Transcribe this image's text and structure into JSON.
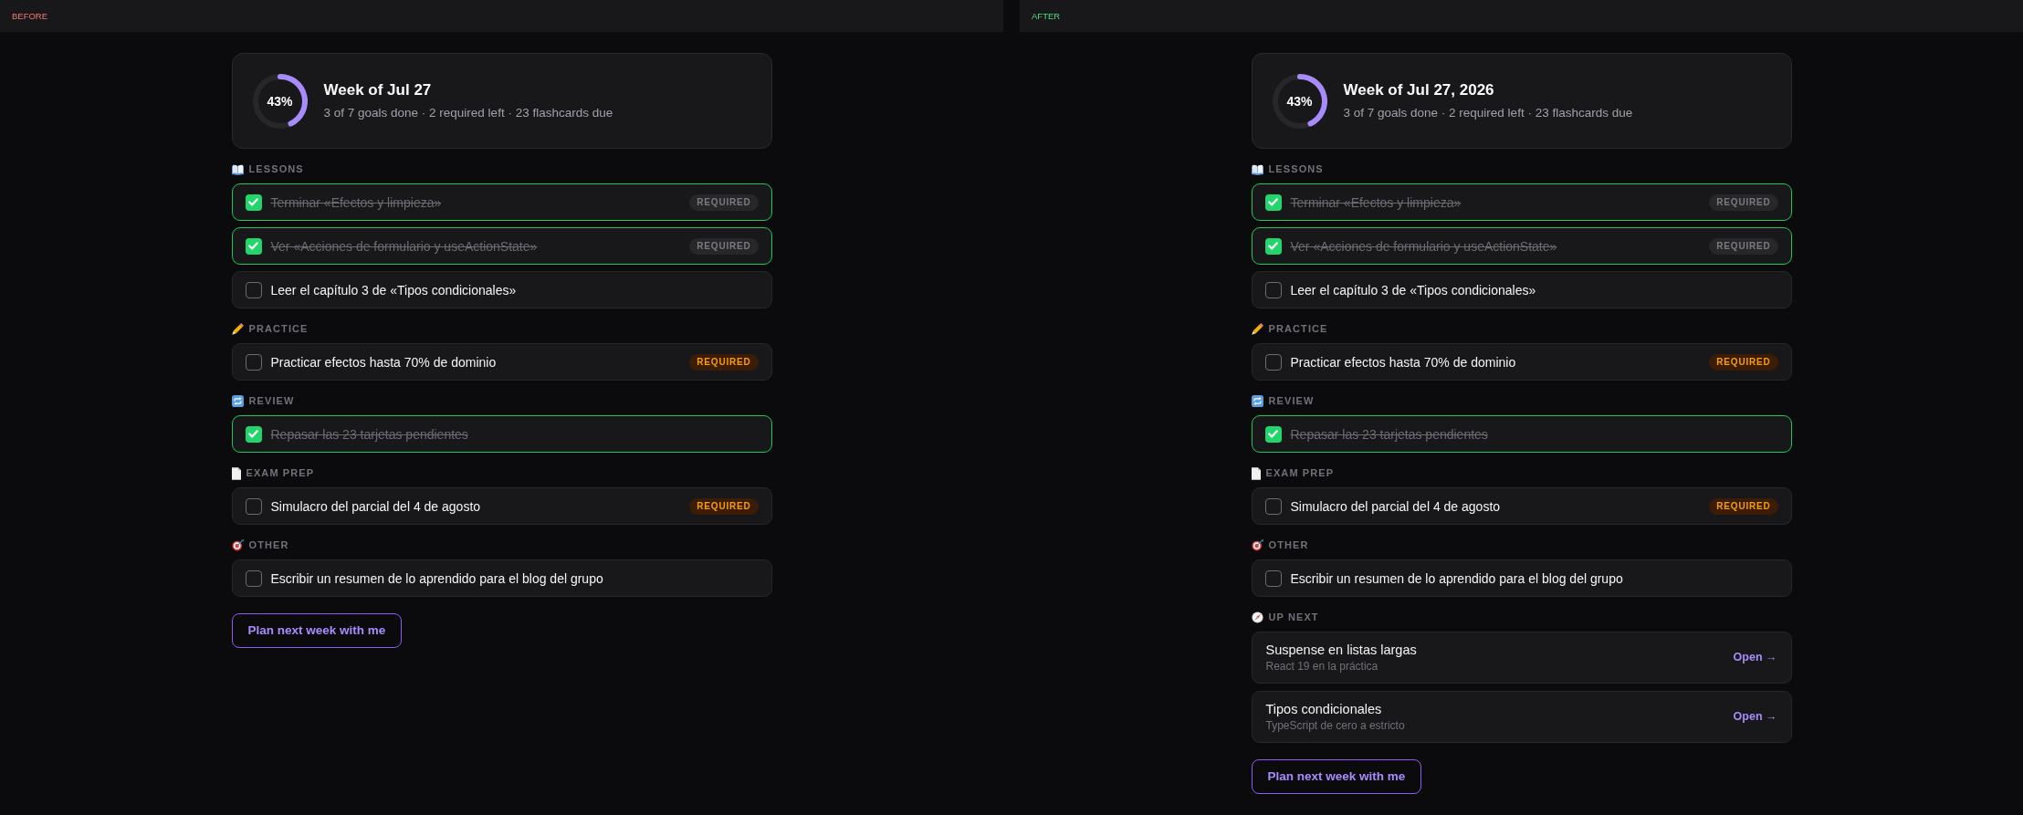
{
  "panes": [
    {
      "label": "BEFORE",
      "color": "#f27a72",
      "summary": {
        "percent": "43%",
        "level": 0.43,
        "title": "Week of Jul 27",
        "subtitle": "3 of 7 goals done · 2 required left · 23 flashcards due"
      },
      "sections": [
        {
          "kind": "lessons",
          "heading": "LESSONS",
          "items": [
            {
              "text": "Terminar «Efectos y limpieza»",
              "checked": true,
              "badge": "REQUIRED"
            },
            {
              "text": "Ver «Acciones de formulario y useActionState»",
              "checked": true,
              "badge": "REQUIRED"
            },
            {
              "text": "Leer el capítulo 3 de «Tipos condicionales»",
              "checked": false
            }
          ]
        },
        {
          "kind": "practice",
          "heading": "PRACTICE",
          "items": [
            {
              "text": "Practicar efectos hasta 70% de dominio",
              "checked": false,
              "badge": "REQUIRED"
            }
          ]
        },
        {
          "kind": "review",
          "heading": "REVIEW",
          "items": [
            {
              "text": "Repasar las 23 tarjetas pendientes",
              "checked": true
            }
          ]
        },
        {
          "kind": "exam_prep",
          "heading": "EXAM PREP",
          "items": [
            {
              "text": "Simulacro del parcial del 4 de agosto",
              "checked": false,
              "badge": "REQUIRED"
            }
          ]
        },
        {
          "kind": "other",
          "heading": "OTHER",
          "items": [
            {
              "text": "Escribir un resumen de lo aprendido para el blog del grupo",
              "checked": false
            }
          ]
        }
      ],
      "button": "Plan next week with me"
    },
    {
      "label": "AFTER",
      "color": "#4ade80",
      "summary": {
        "percent": "43%",
        "level": 0.43,
        "title": "Week of Jul 27, 2026",
        "subtitle": "3 of 7 goals done · 2 required left · 23 flashcards due"
      },
      "sections": [
        {
          "kind": "lessons",
          "heading": "LESSONS",
          "items": [
            {
              "text": "Terminar «Efectos y limpieza»",
              "checked": true,
              "badge": "REQUIRED"
            },
            {
              "text": "Ver «Acciones de formulario y useActionState»",
              "checked": true,
              "badge": "REQUIRED"
            },
            {
              "text": "Leer el capítulo 3 de «Tipos condicionales»",
              "checked": false
            }
          ]
        },
        {
          "kind": "practice",
          "heading": "PRACTICE",
          "items": [
            {
              "text": "Practicar efectos hasta 70% de dominio",
              "checked": false,
              "badge": "REQUIRED"
            }
          ]
        },
        {
          "kind": "review",
          "heading": "REVIEW",
          "items": [
            {
              "text": "Repasar las 23 tarjetas pendientes",
              "checked": true
            }
          ]
        },
        {
          "kind": "exam_prep",
          "heading": "EXAM PREP",
          "items": [
            {
              "text": "Simulacro del parcial del 4 de agosto",
              "checked": false,
              "badge": "REQUIRED"
            }
          ]
        },
        {
          "kind": "other",
          "heading": "OTHER",
          "items": [
            {
              "text": "Escribir un resumen de lo aprendido para el blog del grupo",
              "checked": false
            }
          ]
        },
        {
          "kind": "up_next",
          "heading": "UP NEXT",
          "items": [
            {
              "title": "Suspense en listas largas",
              "subtitle": "React 19 en la práctica",
              "link": "Open →"
            },
            {
              "title": "Tipos condicionales",
              "subtitle": "TypeScript de cero a estricto",
              "link": "Open →"
            }
          ]
        }
      ],
      "button": "Plan next week with me"
    }
  ]
}
